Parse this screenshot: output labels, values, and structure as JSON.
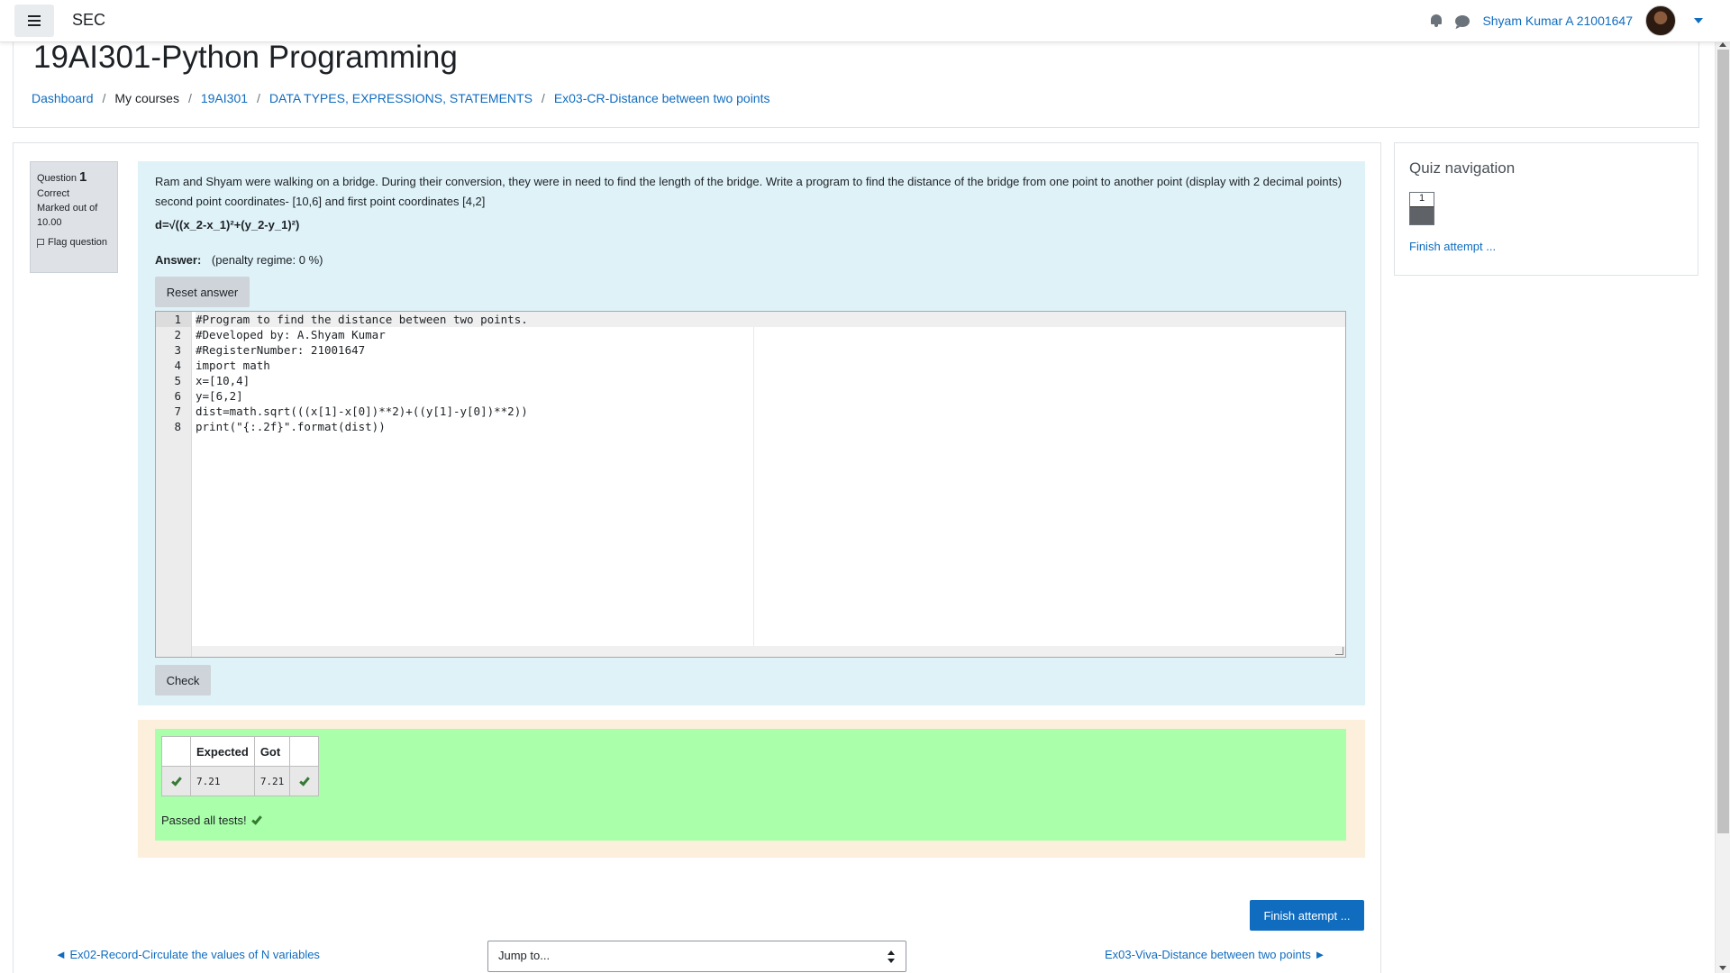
{
  "navbar": {
    "brand": "SEC",
    "username": "Shyam Kumar A 21001647"
  },
  "header": {
    "title": "19AI301-Python Programming",
    "breadcrumb": [
      "Dashboard",
      "My courses",
      "19AI301",
      "DATA TYPES, EXPRESSIONS, STATEMENTS",
      "Ex03-CR-Distance between two points"
    ]
  },
  "question_info": {
    "label": "Question",
    "number": "1",
    "state": "Correct",
    "marked": "Marked out of 10.00",
    "flag": "Flag question"
  },
  "question": {
    "text": "Ram and Shyam were walking on a bridge. During their conversion, they were in need to find the length of the bridge. Write a program to find the distance of the bridge from one point to another point (display with 2 decimal points) second point coordinates- [10,6] and first point coordinates [4,2]",
    "formula": "d=√((x_2-x_1)²+(y_2-y_1)²)",
    "answer_label": "Answer:",
    "penalty": "(penalty regime: 0 %)",
    "reset_label": "Reset answer",
    "check_label": "Check"
  },
  "code_lines": [
    "#Program to find the distance between two points.",
    "#Developed by: A.Shyam Kumar",
    "#RegisterNumber: 21001647",
    "import math",
    "x=[10,4]",
    "y=[6,2]",
    "dist=math.sqrt(((x[1]-x[0])**2)+((y[1]-y[0])**2))",
    "print(\"{:.2f}\".format(dist))"
  ],
  "results": {
    "headers": [
      "",
      "Expected",
      "Got",
      ""
    ],
    "rows": [
      {
        "expected": "7.21",
        "got": "7.21"
      }
    ],
    "passed_text": "Passed all tests!"
  },
  "finish_label": "Finish attempt ...",
  "navigation": {
    "prev": "◄ Ex02-Record-Circulate the values of N variables",
    "jump_placeholder": "Jump to...",
    "next": "Ex03-Viva-Distance between two points ►"
  },
  "quiz_nav": {
    "title": "Quiz navigation",
    "button": "1",
    "finish": "Finish attempt ..."
  },
  "colors": {
    "accent": "#0f6cbf",
    "formulation_bg": "#def2f8",
    "outcome_bg": "#fcefdc",
    "feedback_bg": "#aaffaa",
    "correct_green": "#357a32"
  }
}
